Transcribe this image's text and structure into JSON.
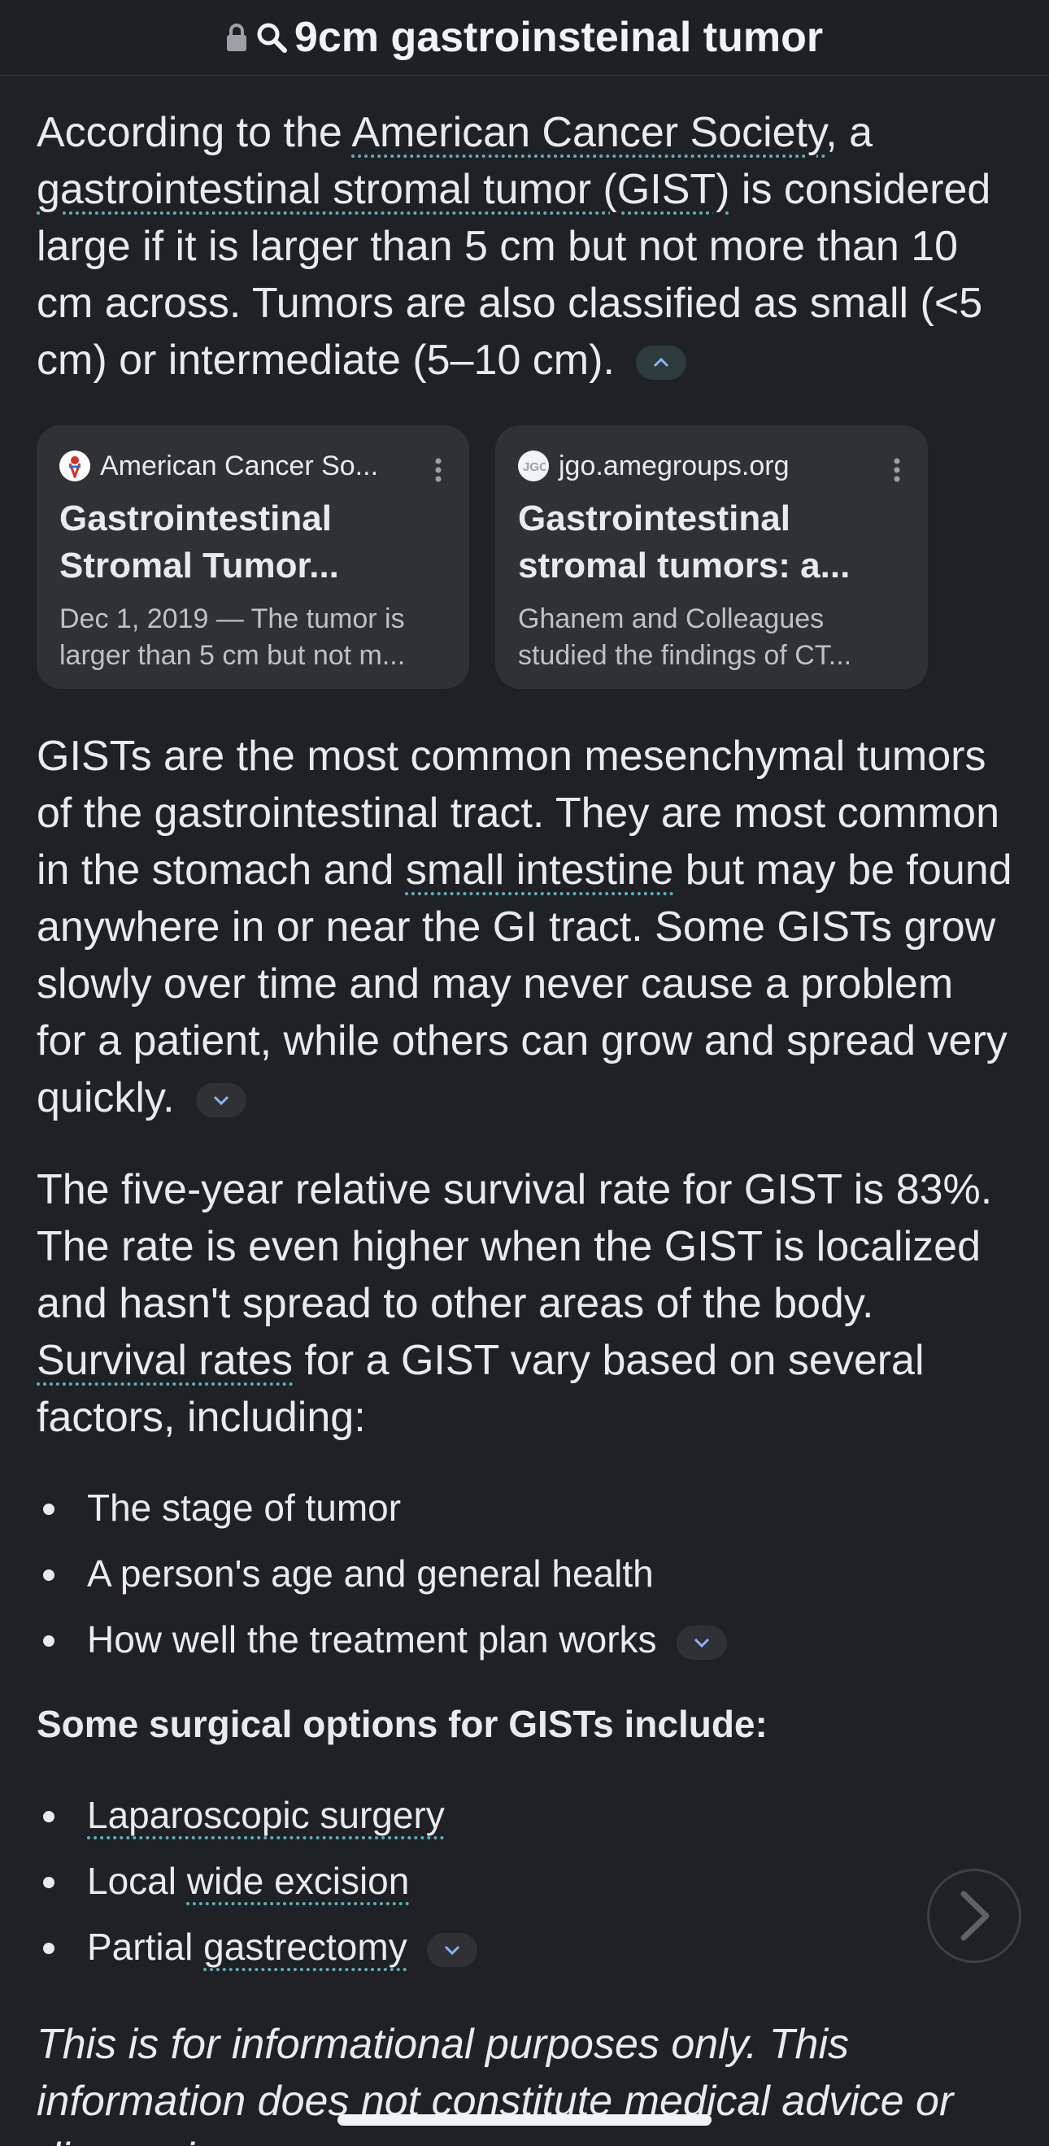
{
  "header": {
    "query": "9cm gastroinsteinal tumor"
  },
  "p1": {
    "t1": "According to the ",
    "link1": "American Cancer Society",
    "t2": ", a ",
    "link2": "gastrointestinal stromal tumor (GIST)",
    "t3": " is considered large if it is larger than 5 cm but not more than 10 cm across. Tumors are also classified as small (<5 cm) or intermediate (5–10 cm)."
  },
  "cards": [
    {
      "source": "American Cancer So...",
      "title": "Gastrointestinal Stromal Tumor...",
      "snippet": "Dec 1, 2019 — The tumor is larger than 5 cm but not m..."
    },
    {
      "source": "jgo.amegroups.org",
      "title": "Gastrointestinal stromal tumors: a...",
      "snippet": "Ghanem and Colleagues studied the findings of CT..."
    }
  ],
  "p2": {
    "t1": "GISTs are the most common mesenchymal tumors of the gastrointestinal tract. They are most common in the stomach and ",
    "link1": "small intestine",
    "t2": " but may be found anywhere in or near the GI tract. Some GISTs grow slowly over time and may never cause a problem for a patient, while others can grow and spread very quickly."
  },
  "p3": {
    "t1": "The five-year relative survival rate for GIST is 83%. The rate is even higher when the GIST is localized and hasn't spread to other areas of the body. ",
    "link1": "Survival rates",
    "t2": " for a GIST vary based on several factors, including:"
  },
  "factors": [
    "The stage of tumor",
    "A person's age and general health",
    "How well the treatment plan works"
  ],
  "surgical": {
    "heading": "Some surgical options for GISTs include:",
    "items": [
      {
        "pre": "",
        "link": "Laparoscopic surgery"
      },
      {
        "pre": "Local ",
        "link": "wide excision"
      },
      {
        "pre": "Partial ",
        "link": "gastrectomy"
      }
    ]
  },
  "disclaimer": "This is for informational purposes only. This information does not constitute medical advice or diagnosis.",
  "colors": {
    "background": "#202124",
    "link_underline": "#5fb0b7",
    "card": "#303134"
  },
  "icons": [
    "lock-icon",
    "search-icon",
    "chevron-up-icon",
    "chevron-down-icon",
    "kebab-menu-icon",
    "chevron-right-icon"
  ]
}
